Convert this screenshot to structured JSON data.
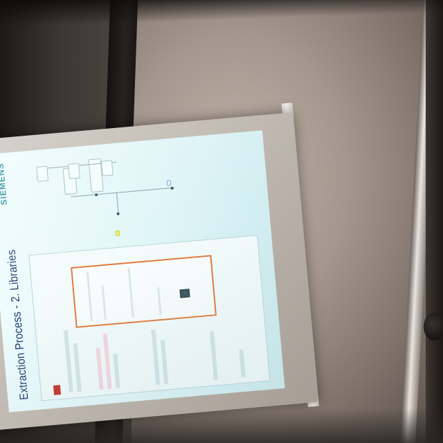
{
  "slide": {
    "title": "Extraction Process - 2. Libraries",
    "brand_name": "SIEMENS",
    "brand_tagline": "",
    "panel_badge": "",
    "panel_header": "",
    "panel_sub_1": "",
    "panel_sub_2": "",
    "node_yellow": "",
    "node_blue": "",
    "page_number": ""
  },
  "colors": {
    "display_bg": "#d8f2f4",
    "highlight_border": "#e07a3a",
    "yellow_node": "#ecf36a",
    "title_text": "#1f3a6a",
    "brand": "#1f8a93"
  }
}
